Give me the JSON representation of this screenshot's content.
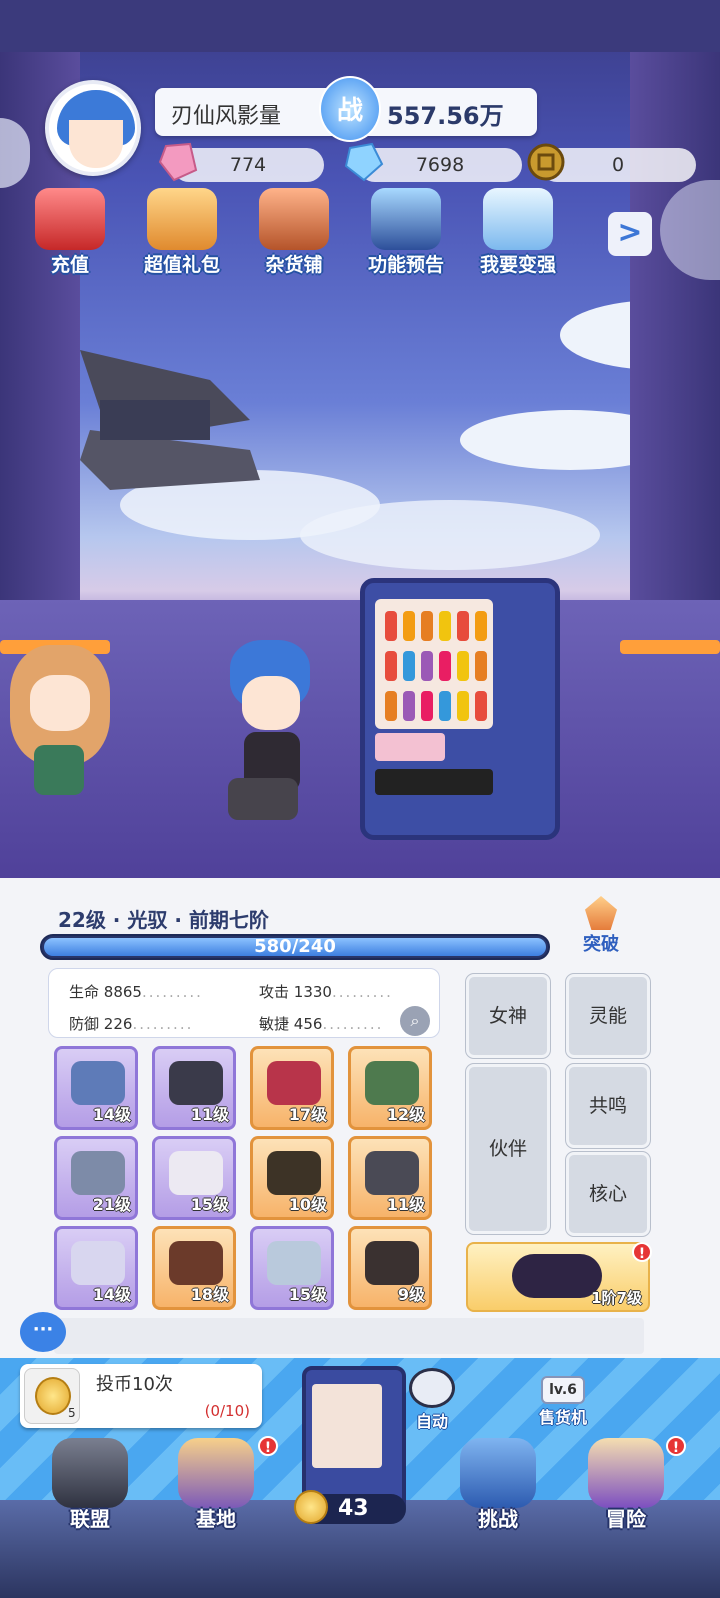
{
  "player": {
    "name": "刃仙风影量",
    "power_badge": "战",
    "power": "557.56万"
  },
  "resources": [
    {
      "icon": "pink-crystal-icon",
      "value": "774"
    },
    {
      "icon": "blue-diamond-icon",
      "value": "7698"
    },
    {
      "icon": "gold-token-icon",
      "value": "0"
    }
  ],
  "top_menu": [
    {
      "icon": "treasure-chest-icon",
      "label": "充值"
    },
    {
      "icon": "gift-box-icon",
      "label": "超值礼包"
    },
    {
      "icon": "shop-crate-icon",
      "label": "杂货铺"
    },
    {
      "icon": "monitor-icon",
      "label": "功能预告"
    },
    {
      "icon": "syringe-icon",
      "label": "我要变强"
    }
  ],
  "top_menu_next": ">",
  "character": {
    "level_line": "22级 · 光驭 · 前期七阶",
    "xp_text": "580/240",
    "xp_fraction": 1.0,
    "breakthrough_label": "突破",
    "stats": [
      {
        "label": "生命",
        "value": "8865"
      },
      {
        "label": "攻击",
        "value": "1330"
      },
      {
        "label": "防御",
        "value": "226"
      },
      {
        "label": "敏捷",
        "value": "456"
      }
    ]
  },
  "equipment": [
    {
      "icon": "gun-icon",
      "level": "14级",
      "rarity": "purple"
    },
    {
      "icon": "helmet-icon",
      "level": "11级",
      "rarity": "purple"
    },
    {
      "icon": "armor-icon",
      "level": "17级",
      "rarity": "orange"
    },
    {
      "icon": "boots-icon",
      "level": "12级",
      "rarity": "orange"
    },
    {
      "icon": "goggles-icon",
      "level": "21级",
      "rarity": "purple"
    },
    {
      "icon": "glove-icon",
      "level": "15级",
      "rarity": "purple"
    },
    {
      "icon": "belt-icon",
      "level": "10级",
      "rarity": "orange"
    },
    {
      "icon": "shorts-icon",
      "level": "11级",
      "rarity": "orange"
    },
    {
      "icon": "wing-icon",
      "level": "14级",
      "rarity": "purple"
    },
    {
      "icon": "bracelet-icon",
      "level": "18级",
      "rarity": "orange"
    },
    {
      "icon": "pendant-icon",
      "level": "15级",
      "rarity": "purple"
    },
    {
      "icon": "vest-icon",
      "level": "9级",
      "rarity": "orange"
    }
  ],
  "side_buttons": {
    "goddess": "女神",
    "psionic": "灵能",
    "partner": "伙伴",
    "resonance": "共鸣",
    "core": "核心"
  },
  "drone": {
    "level": "1阶7级",
    "alert": "!"
  },
  "task": {
    "title": "投币10次",
    "progress": "(0/10)",
    "count": "5"
  },
  "coins": "43",
  "auto_label": "自动",
  "vending": {
    "level": "lv.6",
    "label": "售货机"
  },
  "bottom_nav": [
    {
      "icon": "flag-icon",
      "label": "联盟",
      "alert": ""
    },
    {
      "icon": "house-icon",
      "label": "基地",
      "alert": "!"
    },
    {
      "icon": "boxing-gloves-icon",
      "label": "挑战",
      "alert": ""
    },
    {
      "icon": "pirate-map-icon",
      "label": "冒险",
      "alert": "!"
    }
  ]
}
